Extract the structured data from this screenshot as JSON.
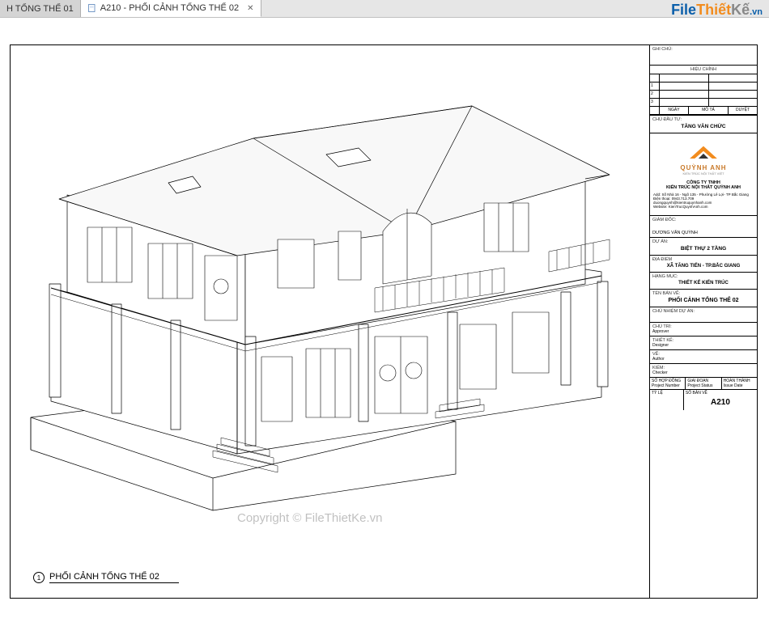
{
  "tabs": {
    "inactive_label": "H TỔNG THỂ 01",
    "active_label": "A210 - PHỐI CẢNH TỔNG THỂ 02"
  },
  "brand": {
    "file": "File",
    "thiet": "Thiết",
    "ke": "Kế",
    "vn": ".vn"
  },
  "drawing": {
    "caption_num": "1",
    "caption_text": "PHỐI CẢNH TỔNG THỂ 02"
  },
  "copyright": "Copyright © FileThietKe.vn",
  "titleblock": {
    "ghi_chu_label": "GHI CHÚ:",
    "hieu_chinh_label": "HIỆU CHỈNH",
    "rev_headers": {
      "ngay": "NGÀY",
      "mota": "MÔ TẢ",
      "duyet": "DUYỆT"
    },
    "chu_dau_tu_label": "CHỦ ĐẦU TƯ:",
    "chu_dau_tu_value": "TĂNG VĂN CHỨC",
    "company_logo_text": "QUỲNH ANH",
    "company_logo_sub": "KIẾN TRÚC NỘI THẤT VIỆT",
    "company_name": "CÔNG TY TNHH\nKIẾN TRÚC NỘI THẤT QUỲNH ANH",
    "address_label": "Add:",
    "address": "Số Nhà 16 - Ngõ 135 - Phường Lê Lợi- TP Bắc Giang",
    "phone_label": "Điện thoại:",
    "phone": "0943.713.709",
    "email": "duongquynh@kientruquynhanh.com",
    "website_label": "Website:",
    "website": "KienTrucQuynhAnh.com",
    "giam_doc_label": "GIÁM ĐỐC:",
    "giam_doc_value": "DƯƠNG VĂN QUỲNH",
    "du_an_label": "DỰ ÁN:",
    "du_an_value": "BIỆT THỰ 2 TẦNG",
    "dia_diem_label": "ĐỊA ĐIỂM",
    "dia_diem_value": "XÃ TĂNG TIẾN - TP.BẮC GIANG",
    "hang_muc_label": "HẠNG MỤC:",
    "hang_muc_value": "THIẾT KẾ KIẾN TRÚC",
    "ten_ban_ve_label": "TÊN BẢN VẼ:",
    "ten_ban_ve_value": "PHỐI CẢNH TỔNG THỂ 02",
    "chu_nhiem_label": "CHỦ NHIỆM DỰ ÁN:",
    "chu_tri_label": "CHỦ TRÌ:",
    "approver": "Approver",
    "thiet_ke_label": "THIẾT KẾ:",
    "designer": "Designer",
    "ve_label": "VẼ:",
    "author": "Author",
    "kiem_label": "KIỂM:",
    "checker": "Checker",
    "footer": {
      "so_hop_dong": "SỐ HỢP ĐỒNG",
      "project_number": "Project Number",
      "giai_doan": "GIAI ĐOẠN",
      "project_status": "Project Status",
      "hoan_thanh": "HOÀN THÀNH",
      "issue_date": "Issue Date",
      "ty_le": "TỶ LỆ",
      "so_ban_ve": "SỐ BẢN VẼ",
      "sheet_number": "A210"
    }
  }
}
